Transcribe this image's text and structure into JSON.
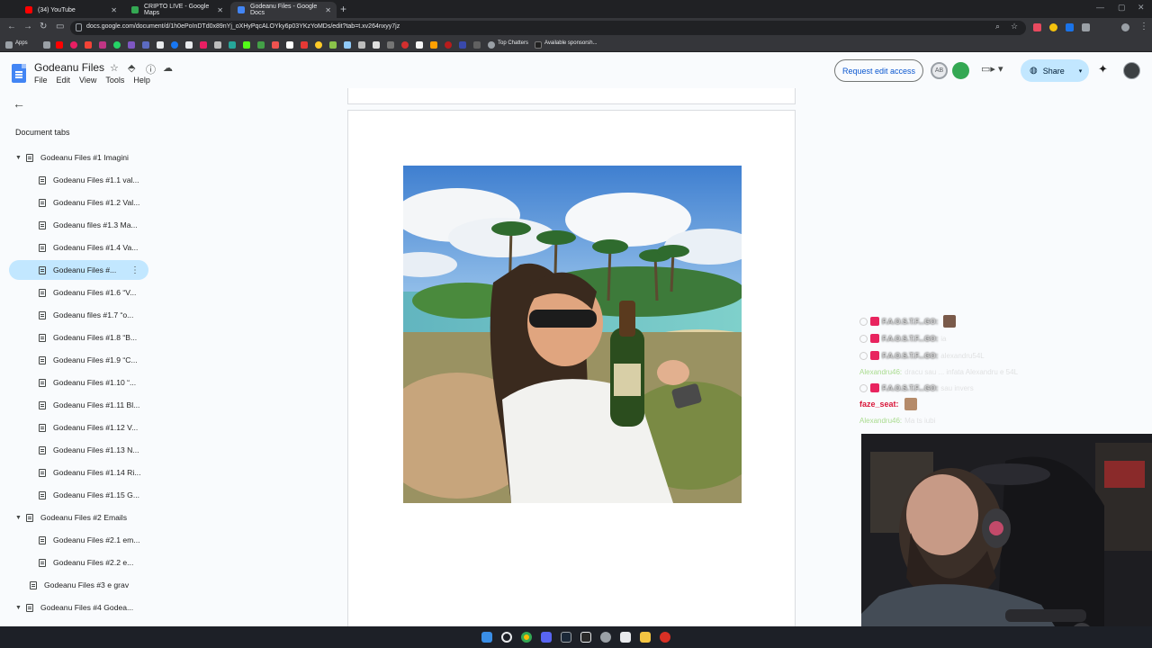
{
  "browser": {
    "tabs": [
      {
        "title": "(34) YouTube",
        "favicon_color": "#ff0000",
        "active": false
      },
      {
        "title": "CRIPTO LIVE - Google Maps",
        "favicon_color": "#34a853",
        "active": false
      },
      {
        "title": "Godeanu Files - Google Docs",
        "favicon_color": "#4285f4",
        "active": true
      }
    ],
    "url": "docs.google.com/document/d/1h0ePoInDTd0x89nYj_oXHyPqcALOYky6p03YKzYoMDs/edit?tab=t.xv264nxyy7jz",
    "bookmarks": {
      "apps": "Apps",
      "top_chatters": "Top Chatters",
      "available": "Available sponsorsh..."
    }
  },
  "doc": {
    "title": "Godeanu Files",
    "menu": [
      "File",
      "Edit",
      "View",
      "Tools",
      "Help"
    ],
    "request_edit_label": "Request edit access",
    "share_label": "Share",
    "avatar_initials": "AB"
  },
  "sidebar": {
    "heading": "Document tabs",
    "tabs": [
      {
        "label": "Godeanu Files #1 Imagini",
        "level": 0,
        "expanded": true
      },
      {
        "label": "Godeanu Files #1.1 val...",
        "level": 1
      },
      {
        "label": "Godeanu Files #1.2 Val...",
        "level": 1
      },
      {
        "label": "Godeanu files #1.3 Ma...",
        "level": 1
      },
      {
        "label": "Godeanu Files #1.4 Va...",
        "level": 1
      },
      {
        "label": "Godeanu Files #...",
        "level": 1,
        "selected": true
      },
      {
        "label": "Godeanu Files #1.6 “V...",
        "level": 1
      },
      {
        "label": "Godeanu files #1.7 “o...",
        "level": 1
      },
      {
        "label": "Godeanu Files #1.8 “B...",
        "level": 1
      },
      {
        "label": "Godeanu Files #1.9 “C...",
        "level": 1
      },
      {
        "label": "Godeanu Files #1.10 “...",
        "level": 1
      },
      {
        "label": "Godeanu Files #1.11 Bl...",
        "level": 1
      },
      {
        "label": "Godeanu Files #1.12 V...",
        "level": 1
      },
      {
        "label": "Godeanu Files #1.13 N...",
        "level": 1
      },
      {
        "label": "Godeanu Files #1.14 Ri...",
        "level": 1
      },
      {
        "label": "Godeanu Files #1.15 G...",
        "level": 1
      },
      {
        "label": "Godeanu Files #2 Emails",
        "level": 0,
        "expanded": true
      },
      {
        "label": "Godeanu Files #2.1 em...",
        "level": 1
      },
      {
        "label": "Godeanu Files #2.2 e...",
        "level": 1
      },
      {
        "label": "Godeanu Files #3 e grav",
        "level": 0,
        "expanded": false
      },
      {
        "label": "Godeanu Files #4 Godea...",
        "level": 0,
        "expanded": true
      }
    ]
  },
  "chat": {
    "lines": [
      {
        "user": "F.A.O.S.T.F...GO:",
        "message": ""
      },
      {
        "user": "F.A.O.S.T.F...GO:",
        "message": "ia"
      },
      {
        "user": "F.A.O.S.T.F...GO:",
        "message": "alexandru54L"
      },
      {
        "user": "Alexandru46:",
        "message": "dracu sau ... infata Alexandru e 54L"
      },
      {
        "user": "F.A.O.S.T.F...GO:",
        "message": "sau invers"
      },
      {
        "user": "faze_seat:",
        "message": ""
      },
      {
        "user": "Alexandru46:",
        "message": "Ma ts iubi"
      }
    ]
  }
}
